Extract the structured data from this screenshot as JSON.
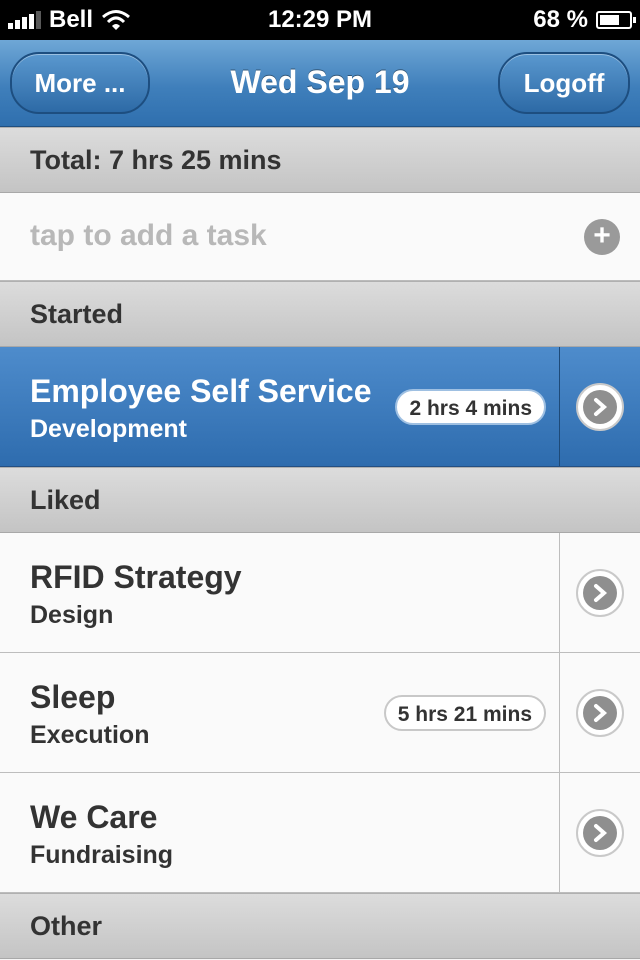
{
  "status_bar": {
    "carrier": "Bell",
    "time": "12:29 PM",
    "battery_percent": "68 %",
    "battery_level": 0.68
  },
  "nav": {
    "left_button": "More ...",
    "title": "Wed Sep 19",
    "right_button": "Logoff"
  },
  "total": "Total: 7 hrs 25 mins",
  "add_task": {
    "placeholder": "tap to add a task",
    "icon": "plus-icon"
  },
  "sections": {
    "started": "Started",
    "liked": "Liked",
    "other": "Other"
  },
  "started_tasks": [
    {
      "name": "Employee Self Service",
      "category": "Development",
      "duration": "2 hrs 4 mins"
    }
  ],
  "liked_tasks": [
    {
      "name": "RFID Strategy",
      "category": "Design",
      "duration": ""
    },
    {
      "name": "Sleep",
      "category": "Execution",
      "duration": "5 hrs 21 mins"
    },
    {
      "name": "We Care",
      "category": "Fundraising",
      "duration": ""
    }
  ],
  "colors": {
    "nav_blue": "#3f7fbb",
    "active_row": "#2e6cae",
    "section_gray": "#c4c4c4"
  }
}
